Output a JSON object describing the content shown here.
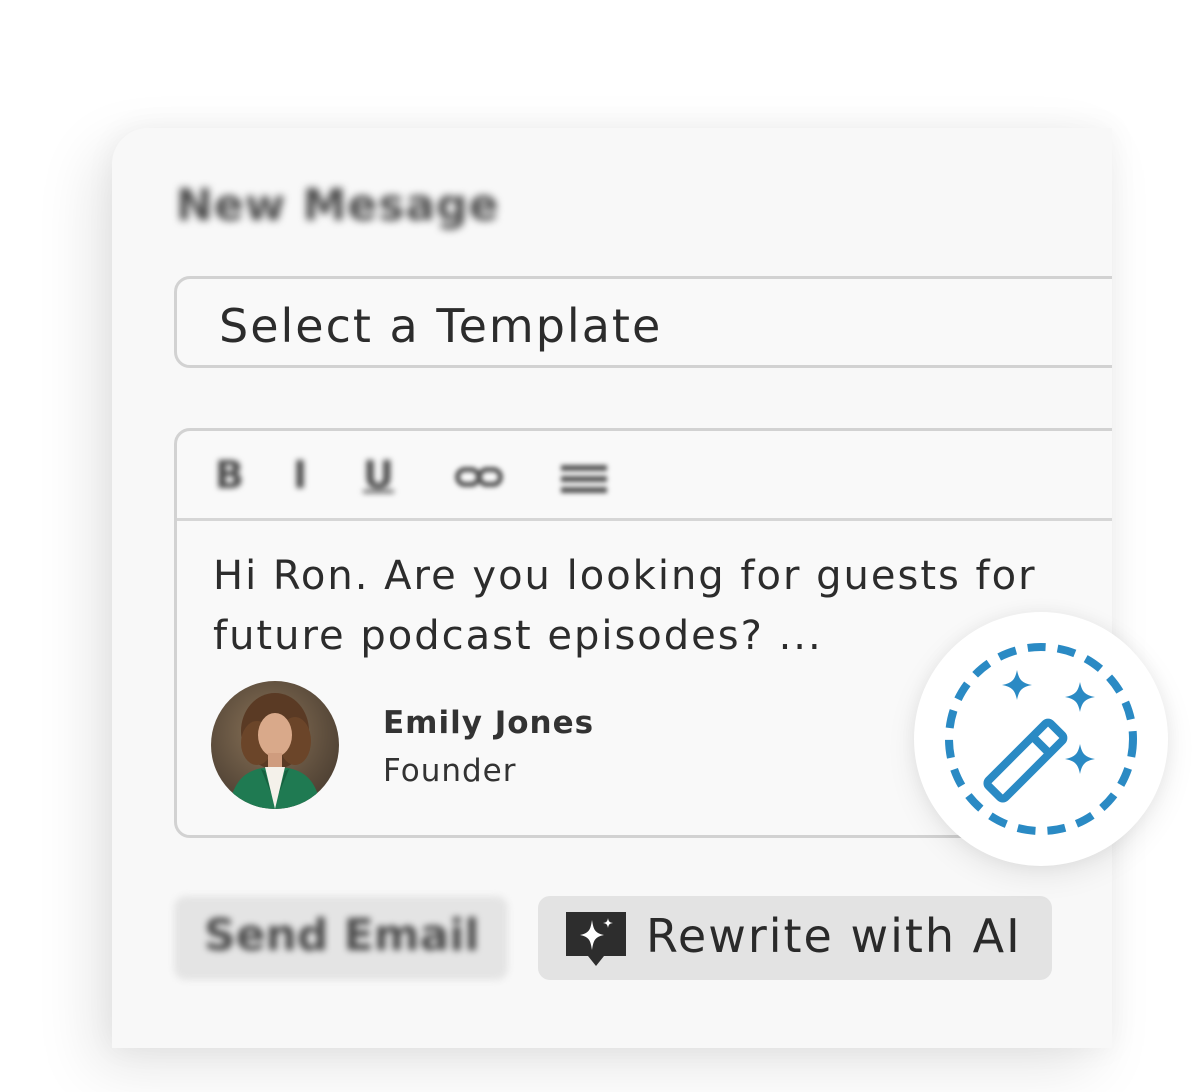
{
  "composer": {
    "title": "New Mesage",
    "template_select": {
      "placeholder": "Select a Template"
    },
    "toolbar": {
      "bold_label": "B",
      "italic_label": "I",
      "underline_label": "U",
      "link_icon": "link-icon",
      "list_icon": "list-icon"
    },
    "body_text": "Hi Ron. Are you looking for guests for\nfuture podcast episodes? ...",
    "signature": {
      "name": "Emily Jones",
      "role": "Founder"
    },
    "send_button_label": "Send Email",
    "rewrite_button": {
      "label": "Rewrite with AI",
      "icon": "ai-sparkle-icon"
    },
    "magic_badge_icon": "magic-wand-icon"
  },
  "colors": {
    "accent_blue": "#2a8ac4",
    "dark_icon": "#2d2d2d",
    "card_bg": "#f8f8f8",
    "border": "#d2d2d2"
  }
}
